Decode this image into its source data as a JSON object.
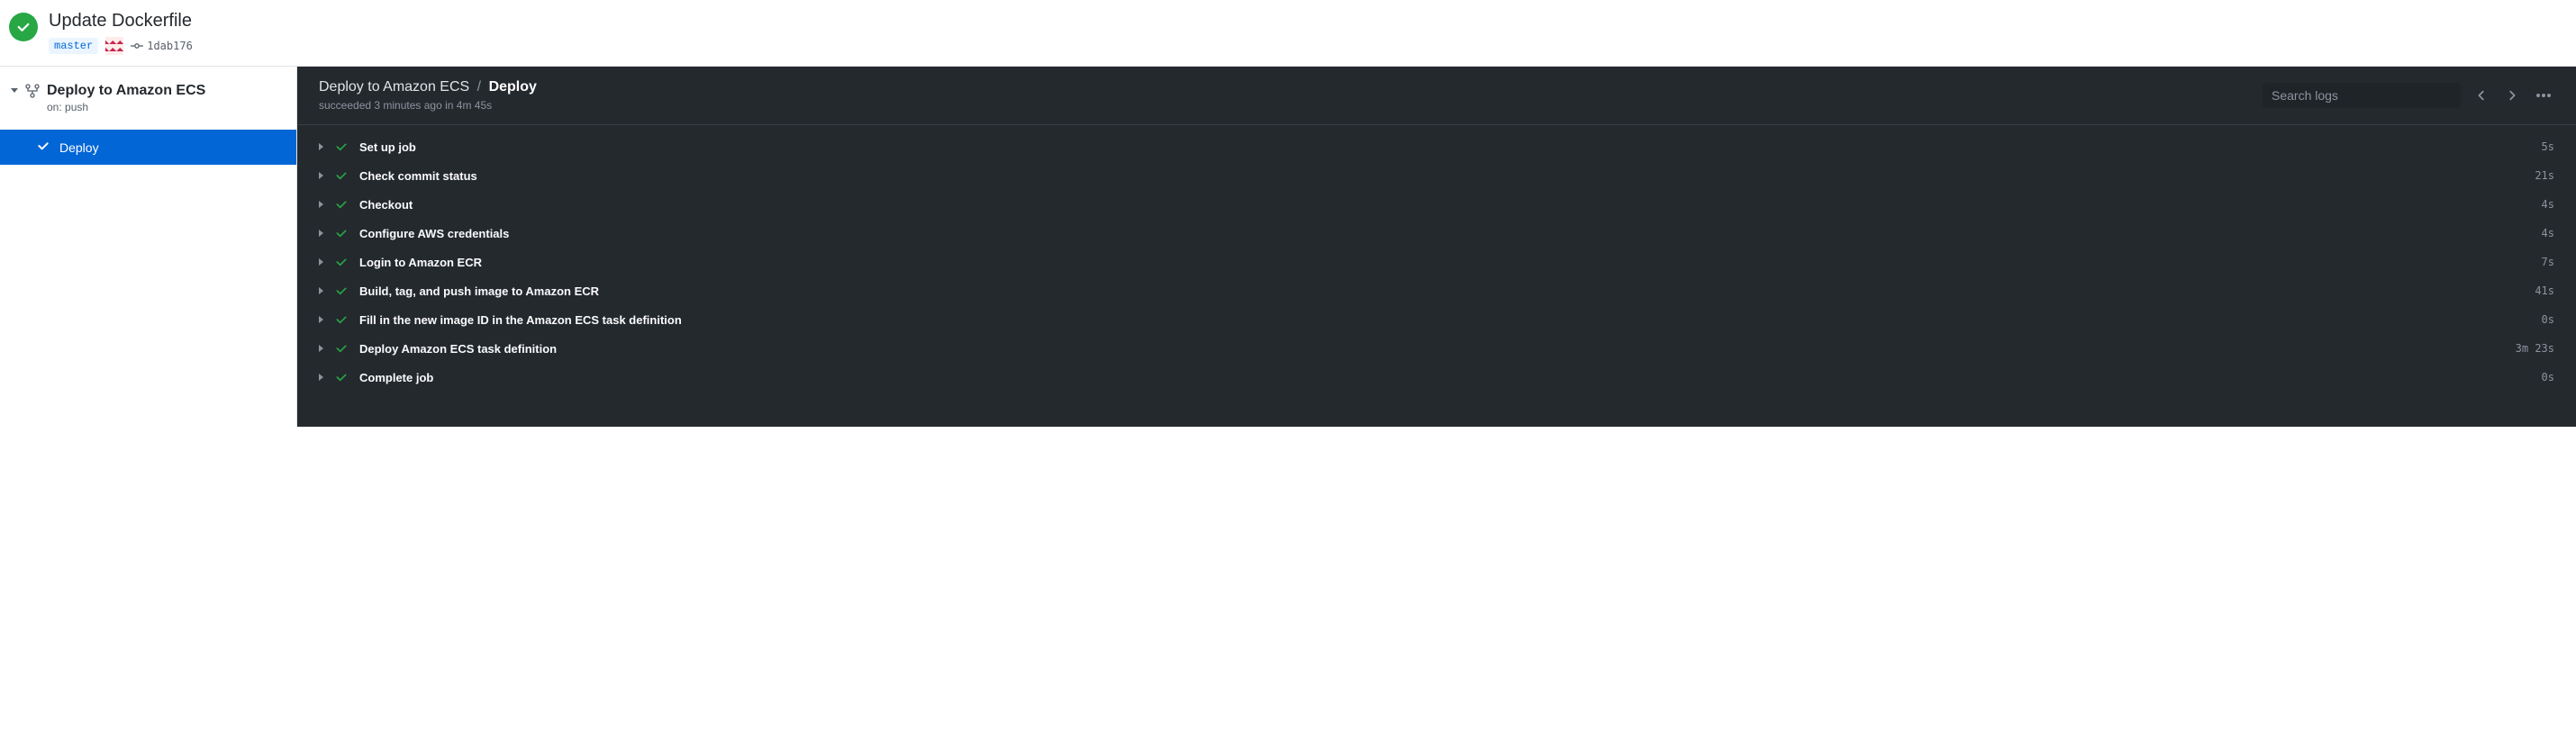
{
  "header": {
    "title": "Update Dockerfile",
    "branch": "master",
    "commit": "1dab176"
  },
  "sidebar": {
    "workflow_name": "Deploy to Amazon ECS",
    "on_label": "on: push",
    "job_label": "Deploy"
  },
  "content": {
    "breadcrumb_workflow": "Deploy to Amazon ECS",
    "breadcrumb_sep": "/",
    "breadcrumb_job": "Deploy",
    "subtitle": "succeeded 3 minutes ago in 4m 45s",
    "search_placeholder": "Search logs"
  },
  "steps": [
    {
      "name": "Set up job",
      "time": "5s"
    },
    {
      "name": "Check commit status",
      "time": "21s"
    },
    {
      "name": "Checkout",
      "time": "4s"
    },
    {
      "name": "Configure AWS credentials",
      "time": "4s"
    },
    {
      "name": "Login to Amazon ECR",
      "time": "7s"
    },
    {
      "name": "Build, tag, and push image to Amazon ECR",
      "time": "41s"
    },
    {
      "name": "Fill in the new image ID in the Amazon ECS task definition",
      "time": "0s"
    },
    {
      "name": "Deploy Amazon ECS task definition",
      "time": "3m 23s"
    },
    {
      "name": "Complete job",
      "time": "0s"
    }
  ]
}
